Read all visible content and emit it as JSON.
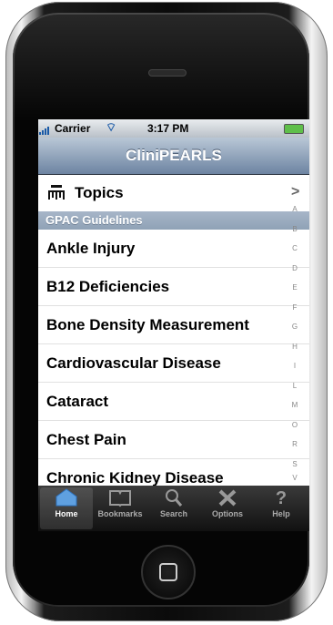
{
  "status": {
    "carrier": "Carrier",
    "time": "3:17 PM"
  },
  "nav": {
    "title": "CliniPEARLS"
  },
  "topics": {
    "label": "Topics",
    "chevron": ">"
  },
  "section": {
    "title": "GPAC Guidelines"
  },
  "items": [
    {
      "label": "Ankle Injury"
    },
    {
      "label": "B12 Deficiencies"
    },
    {
      "label": "Bone Density Measurement"
    },
    {
      "label": "Cardiovascular Disease"
    },
    {
      "label": "Cataract"
    },
    {
      "label": "Chest Pain"
    },
    {
      "label": "Chronic Kidney Disease"
    }
  ],
  "index": [
    "A",
    "B",
    "C",
    "D",
    "E",
    "F",
    "G",
    "H",
    "I",
    "L",
    "M",
    "O",
    "R",
    "S",
    "V"
  ],
  "tabs": [
    {
      "label": "Home",
      "icon": "home-icon"
    },
    {
      "label": "Bookmarks",
      "icon": "book-icon"
    },
    {
      "label": "Search",
      "icon": "search-icon"
    },
    {
      "label": "Options",
      "icon": "tools-icon"
    },
    {
      "label": "Help",
      "icon": "question-icon"
    }
  ],
  "colors": {
    "navbar": "#6d84a2",
    "section": "#97a8bc",
    "battery": "#5fbf4a"
  }
}
